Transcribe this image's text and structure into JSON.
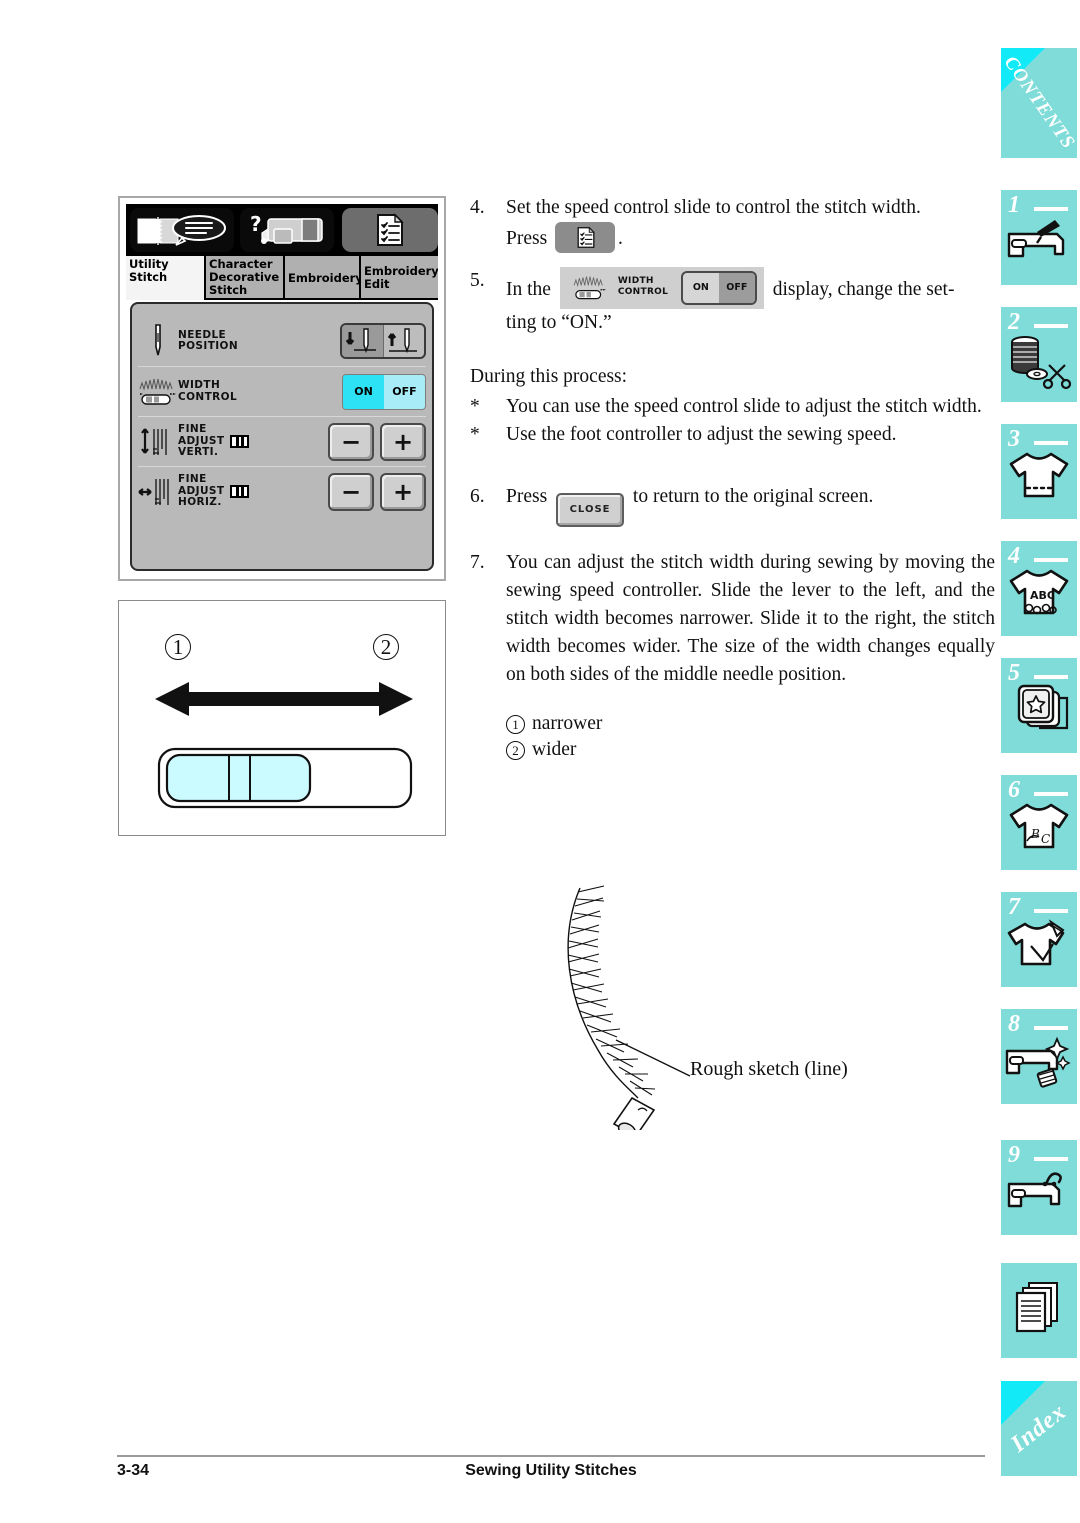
{
  "page": {
    "number": "3-34",
    "footer_title": "Sewing Utility Stitches"
  },
  "lcd": {
    "toolbar": [
      {
        "icon": "manual-book-icon",
        "state": "dark"
      },
      {
        "icon": "machine-help-icon",
        "state": "dark"
      },
      {
        "icon": "settings-list-icon",
        "state": "selected"
      }
    ],
    "tabs": [
      {
        "label": "Utility Stitch",
        "line1": "Utility",
        "line2": "Stitch",
        "active": true
      },
      {
        "label": "Character Decorative Stitch",
        "line1": "Character",
        "line2": "Decorative",
        "line3": "Stitch",
        "active": false
      },
      {
        "label": "Embroidery",
        "line1": "Embroidery",
        "active": false
      },
      {
        "label": "Embroidery Edit",
        "line1": "Embroidery",
        "line2": "Edit",
        "active": false
      }
    ],
    "rows": [
      {
        "icon": "needle-icon",
        "label_line1": "NEEDLE",
        "label_line2": "POSITION",
        "control": "needle-position-toggle",
        "options": [
          "needle-down",
          "needle-up"
        ],
        "selected": "needle-down"
      },
      {
        "icon": "width-slider-icon",
        "label_line1": "WIDTH",
        "label_line2": "CONTROL",
        "control": "on-off-toggle",
        "options": [
          "ON",
          "OFF"
        ],
        "selected": "ON"
      },
      {
        "icon": "vertical-arrows-icon",
        "label_line1": "FINE",
        "label_line2": "ADJUST",
        "label_line3": "VERTI.",
        "control": "minus-plus",
        "minus": "−",
        "plus": "+"
      },
      {
        "icon": "horizontal-arrows-icon",
        "label_line1": "FINE",
        "label_line2": "ADJUST",
        "label_line3": "HORIZ.",
        "control": "minus-plus",
        "minus": "−",
        "plus": "+"
      }
    ]
  },
  "slider_diagram": {
    "marker_left": "1",
    "marker_right": "2",
    "caption": "speed-control-slide"
  },
  "instructions": {
    "step4": {
      "number": "4.",
      "text_before": "Set the speed control slide to control the stitch width.",
      "press_word": "Press",
      "period": "."
    },
    "step5": {
      "number": "5.",
      "lead": "In the",
      "widget": {
        "label_line1": "WIDTH",
        "label_line2": "CONTROL",
        "on": "ON",
        "off": "OFF",
        "selected": "OFF"
      },
      "tail": "display, change the set-",
      "tail2": "ting to “ON.”"
    },
    "during_header": "During this process:",
    "bullets": [
      {
        "marker": "*",
        "text": "You can use the speed control slide to adjust the stitch width."
      },
      {
        "marker": "*",
        "text": "Use the foot controller to adjust the sewing speed."
      }
    ],
    "step6": {
      "number": "6.",
      "press_word": "Press",
      "button_label": "CLOSE",
      "tail": "to return to the original screen."
    },
    "step7": {
      "number": "7.",
      "text": "You can adjust the stitch width during sewing by moving the sewing speed controller. Slide the lever to the left, and the stitch width becomes narrower. Slide it to the right, the stitch width becomes wider. The size of the width changes equally on both sides of the middle needle position."
    },
    "legend": [
      {
        "marker": "1",
        "text": "narrower"
      },
      {
        "marker": "2",
        "text": "wider"
      }
    ]
  },
  "sketch": {
    "label": "Rough sketch (line)"
  },
  "sidebar": {
    "accent_color": "#7fdcd8",
    "corner_color": "#12eaf7",
    "items": [
      {
        "id": "contents",
        "label": "CONTENTS",
        "type": "word",
        "number": ""
      },
      {
        "id": "ch1",
        "label": "",
        "type": "icon",
        "number": "1",
        "icon": "sewing-machine-needle-icon"
      },
      {
        "id": "ch2",
        "label": "",
        "type": "icon",
        "number": "2",
        "icon": "thread-spool-scissors-icon"
      },
      {
        "id": "ch3",
        "label": "",
        "type": "icon",
        "number": "3",
        "icon": "tshirt-stitch-icon"
      },
      {
        "id": "ch4",
        "label": "",
        "type": "icon",
        "number": "4",
        "icon": "tshirt-abc-icon"
      },
      {
        "id": "ch5",
        "label": "",
        "type": "icon",
        "number": "5",
        "icon": "embroidery-hoop-star-icon"
      },
      {
        "id": "ch6",
        "label": "",
        "type": "icon",
        "number": "6",
        "icon": "tshirt-letters-icon"
      },
      {
        "id": "ch7",
        "label": "",
        "type": "icon",
        "number": "7",
        "icon": "tshirt-edit-icon"
      },
      {
        "id": "ch8",
        "label": "",
        "type": "icon",
        "number": "8",
        "icon": "machine-sparkle-icon"
      },
      {
        "id": "ch9",
        "label": "",
        "type": "icon",
        "number": "9",
        "icon": "machine-question-icon"
      },
      {
        "id": "appendix",
        "label": "",
        "type": "icon",
        "number": "",
        "icon": "pages-stack-icon"
      },
      {
        "id": "index",
        "label": "Index",
        "type": "word",
        "number": ""
      }
    ]
  }
}
